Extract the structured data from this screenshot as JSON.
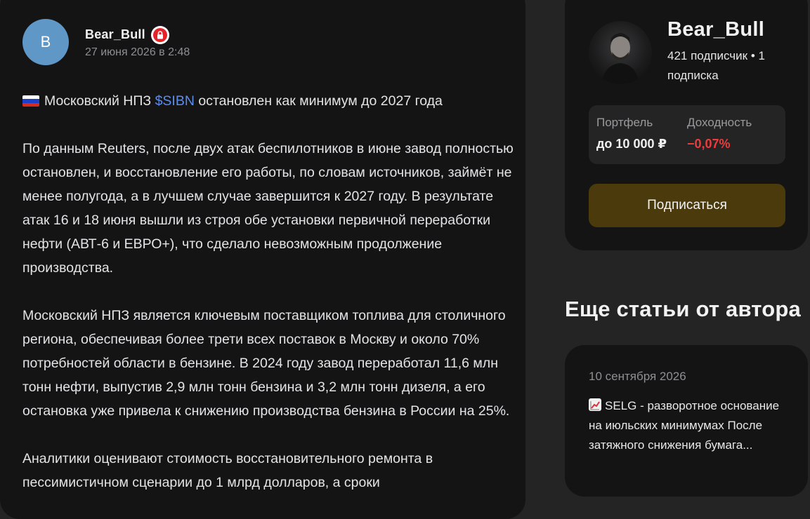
{
  "post": {
    "author_initial": "B",
    "author_name": "Bear_Bull",
    "date": "27 июня 2026 в 2:48",
    "headline_prefix": "Московский НПЗ ",
    "ticker": "$SIBN",
    "headline_suffix": " остановлен как минимум до 2027 года",
    "paragraphs": [
      "По данным Reuters, после двух атак беспилотников в июне завод полностью остановлен, и восстановление его работы, по словам источников, займёт не менее полугода, а в лучшем случае завершится к 2027 году. В результате атак 16 и 18 июня вышли из строя обе установки первичной переработки нефти (АВТ-6 и ЕВРО+), что сделало невозможным продолжение производства.",
      "Московский НПЗ является ключевым поставщиком топлива для столичного региона, обеспечивая более трети всех поставок в Москву и около 70% потребностей области в бензине. В 2024 году завод переработал 11,6 млн тонн нефти, выпустив 2,9 млн тонн бензина и 3,2 млн тонн дизеля, а его остановка уже привела к снижению производства бензина в России на 25%.",
      "Аналитики оценивают стоимость восстановительного ремонта в пессимистичном сценарии до 1 млрд долларов, а сроки"
    ]
  },
  "profile": {
    "name": "Bear_Bull",
    "stats": "421 подписчик • 1 подписка",
    "portfolio_label": "Портфель",
    "portfolio_value": "до 10 000 ₽",
    "yield_label": "Доходность",
    "yield_value": "−0,07%",
    "subscribe_label": "Подписаться"
  },
  "more_articles": {
    "title": "Еще статьи от автора",
    "items": [
      {
        "date": "10 сентября 2026",
        "text": "SELG - разворотное основание на июльских минимумах После затяжного снижения бумага..."
      }
    ]
  },
  "colors": {
    "background": "#242425",
    "card": "#141415",
    "accent_link": "#5b8dee",
    "negative": "#ee3b3b",
    "subscribe_button": "#4a3a0c",
    "avatar": "#5f97c7"
  },
  "icons": {
    "lock_badge": "lock-icon",
    "flag": "russia-flag-icon",
    "article_emoji": "chart-increasing-icon"
  }
}
